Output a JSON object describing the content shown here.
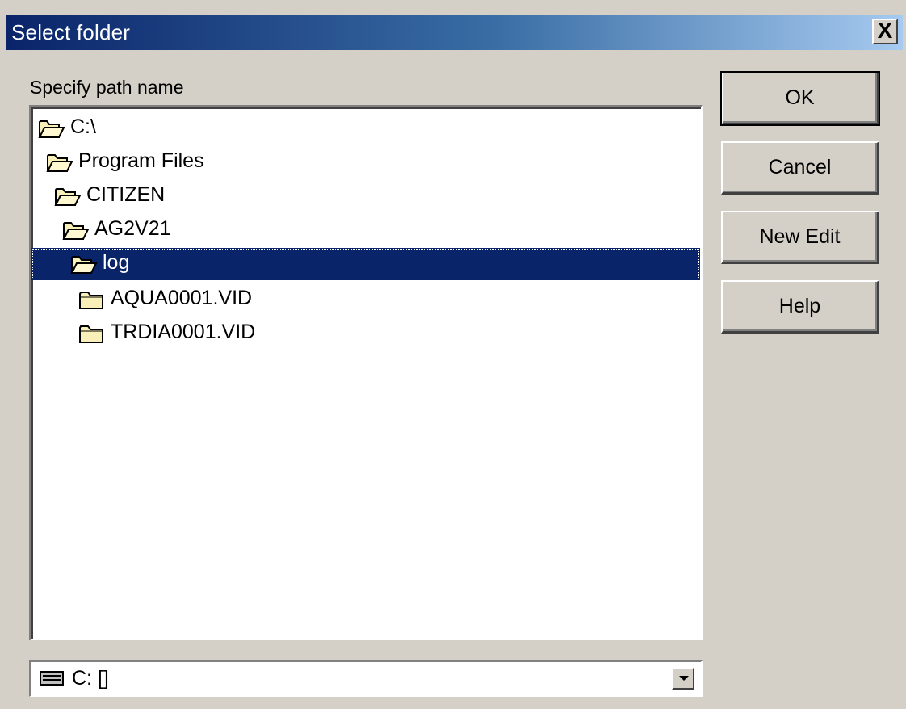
{
  "window": {
    "title": "Select folder",
    "close_symbol": "X"
  },
  "path_label": "Specify path name",
  "tree": [
    {
      "label": "C:\\",
      "icon": "open-folder-icon",
      "selected": false
    },
    {
      "label": "Program Files",
      "icon": "open-folder-icon",
      "selected": false
    },
    {
      "label": "CITIZEN",
      "icon": "open-folder-icon",
      "selected": false
    },
    {
      "label": "AG2V21",
      "icon": "open-folder-icon",
      "selected": false
    },
    {
      "label": "log",
      "icon": "open-folder-icon",
      "selected": true
    },
    {
      "label": "AQUA0001.VID",
      "icon": "closed-folder-icon",
      "selected": false
    },
    {
      "label": "TRDIA0001.VID",
      "icon": "closed-folder-icon",
      "selected": false
    }
  ],
  "drive": {
    "value": "C: []",
    "icon": "drive-icon"
  },
  "buttons": {
    "ok": "OK",
    "cancel": "Cancel",
    "new_edit": "New Edit",
    "help": "Help"
  },
  "colors": {
    "selection": "#0a246a",
    "title_start": "#0a246a",
    "title_end": "#a6caf0",
    "folder_fill": "#f8f0b8",
    "face": "#d4d0c8"
  }
}
